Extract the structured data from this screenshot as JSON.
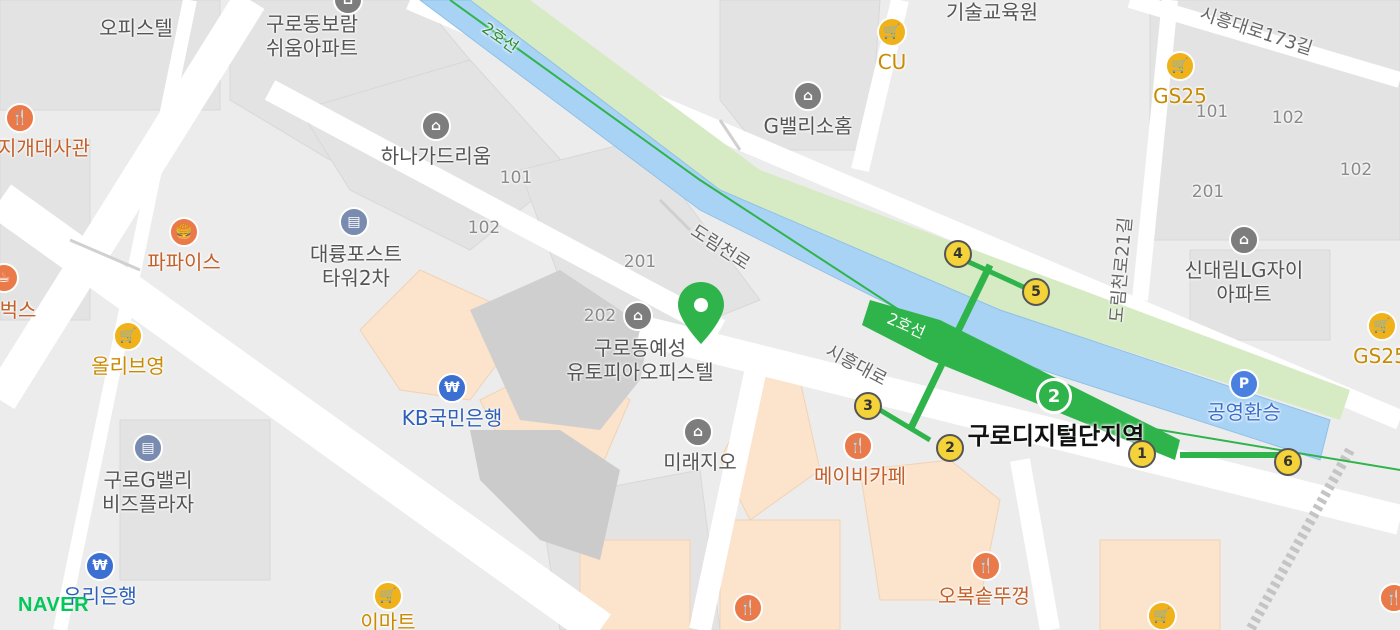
{
  "map": {
    "attribution": "NAVER",
    "colors": {
      "line2": "#2fb44b",
      "river": "#a9d3f5",
      "greenbelt": "#d6ebc3",
      "block": "#fbe3cc",
      "road": "#ffffff"
    },
    "labels": {
      "gurodong_borum": "구로동보람\n쉬움아파트",
      "officetel_top": "오피스텔",
      "jigae": "지개대사관",
      "hana_garden": "하나가드리움",
      "daeryung": "대륭포스트\n타워2차",
      "papais": "파파이스",
      "olive_young": "올리브영",
      "kb_bank": "KB국민은행",
      "guro_gvalley": "구로G밸리\n비즈플라자",
      "woori": "우리은행",
      "emart": "이마트",
      "bux": "벅스",
      "gurodong_yeseong": "구로동예성\n유토피아오피스텔",
      "miraejio": "미래지오",
      "gvalley_home": "G밸리소홈",
      "cu": "CU",
      "tech_edu": "기술교육원",
      "gs25_a": "GS25",
      "gs25_b": "GS25",
      "sindaerim_lg": "신대림LG자이\n아파트",
      "gongyeong": "공영환승",
      "maybe_cafe": "메이비카페",
      "obok": "오복솥뚜껑",
      "station": "구로디지털단지역",
      "road_dorim": "도림천로",
      "road_siheung": "시흥대로",
      "road_siheung173": "시흥대로173길",
      "road_dorim21": "도림천로21길",
      "line2_a": "2호선",
      "line2_b": "2호선",
      "n101_a": "101",
      "n102_a": "102",
      "n201_a": "201",
      "n202": "202",
      "n101_b": "101",
      "n102_b": "102",
      "n201_b": "201",
      "n102_c": "102"
    },
    "exits": [
      "1",
      "2",
      "3",
      "4",
      "5",
      "6"
    ],
    "station_badge": "2",
    "icons": {
      "food": "fork-knife-icon",
      "shop": "shopping-basket-icon",
      "bank": "won-icon",
      "building": "building-icon",
      "parking": "P"
    }
  }
}
